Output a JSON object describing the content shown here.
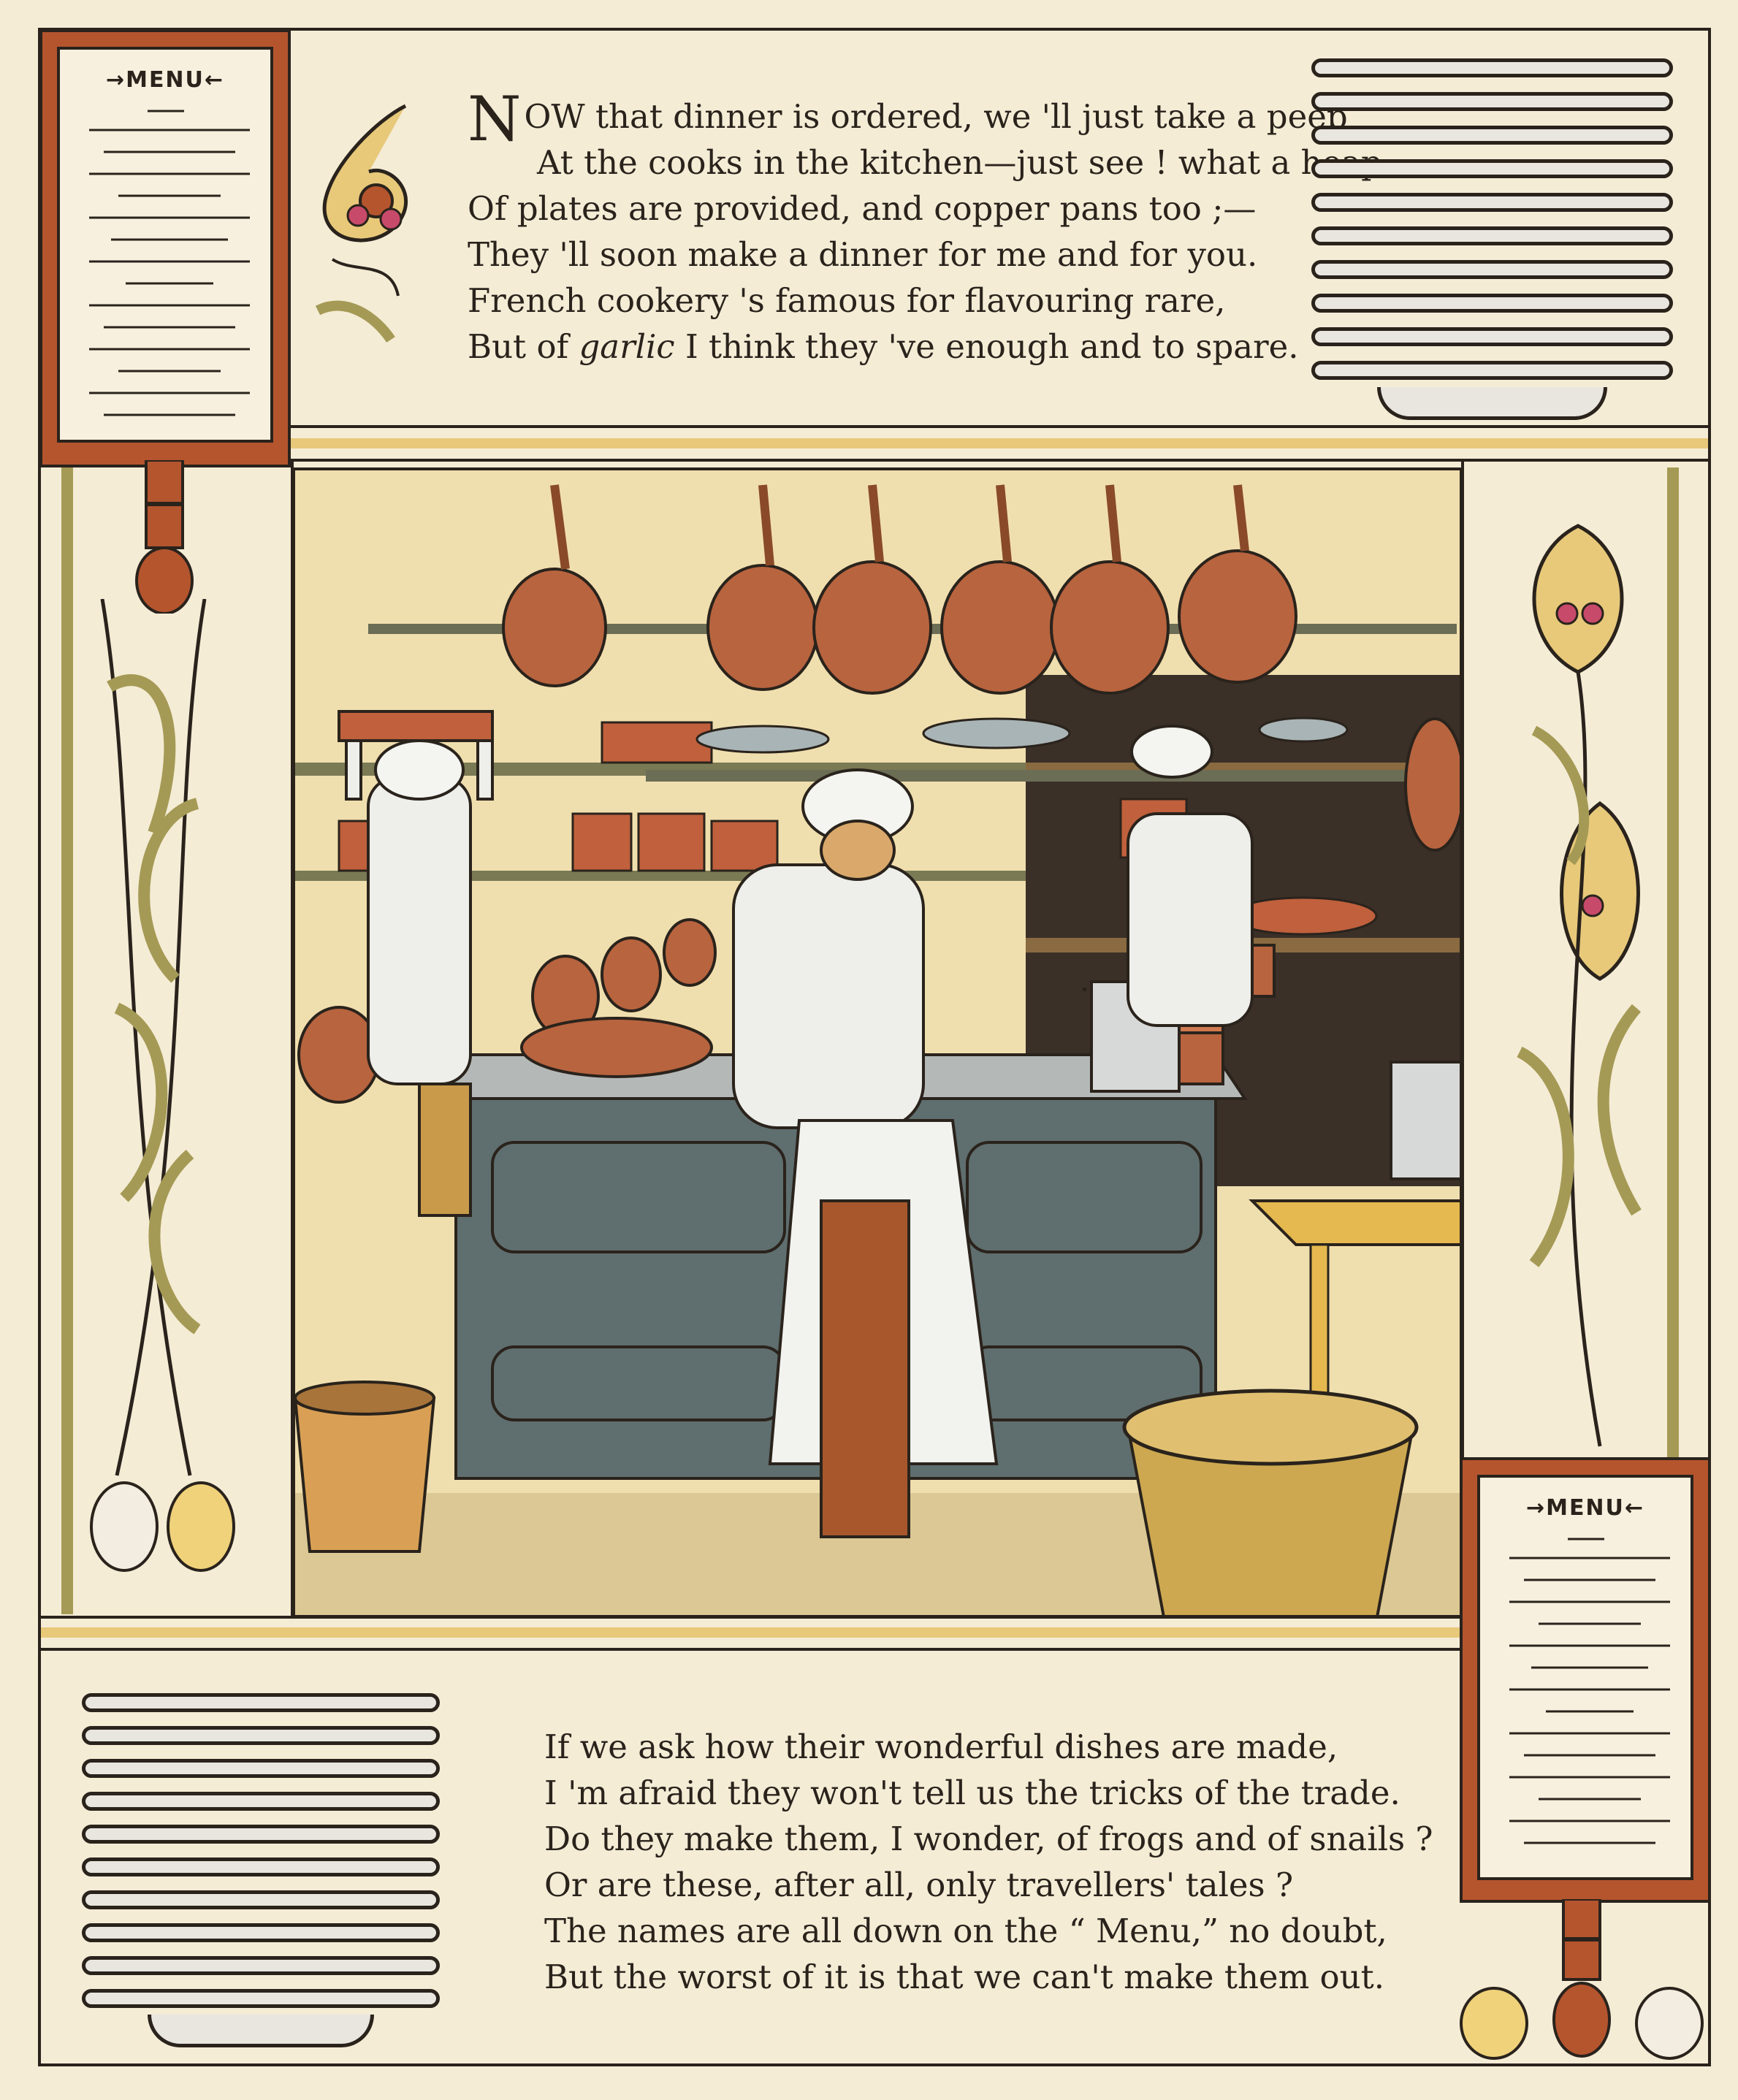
{
  "top_poem": {
    "lines": [
      "OW that dinner is ordered, we 'll just take a peep",
      "At the cooks in the kitchen—just see ! what a heap",
      "Of plates are provided, and copper pans too ;—",
      "They 'll soon make a dinner for me and for you.",
      "French cookery 's famous for flavouring rare,"
    ],
    "drop_cap": "N",
    "last_line_start": "But of ",
    "last_line_italic": "garlic",
    "last_line_end": " I think they 've enough and to spare."
  },
  "bottom_poem": {
    "lines": [
      "If we ask how their wonderful dishes are made,",
      "I 'm afraid they won't tell us the tricks of the trade.",
      "Do they make them, I wonder, of frogs and of snails ?",
      "Or are these, after all, only travellers' tales ?",
      "The names are all down on the “ Menu,” no doubt,",
      "But the worst of it is that we can't make them out."
    ]
  },
  "menu_card_top": {
    "title": "→MENU←"
  },
  "menu_card_bottom": {
    "title": "→MENU←"
  },
  "colors": {
    "paper": "#f5ecd6",
    "ink": "#2a231c",
    "copper": "#b5552e",
    "olive": "#a59a55",
    "stove": "#5f6e6e",
    "cream_band": "#e8c97a"
  },
  "icons": [
    "menu-card-icon",
    "plate-stack-icon",
    "garlic-vine-icon",
    "kitchen-illustration"
  ]
}
